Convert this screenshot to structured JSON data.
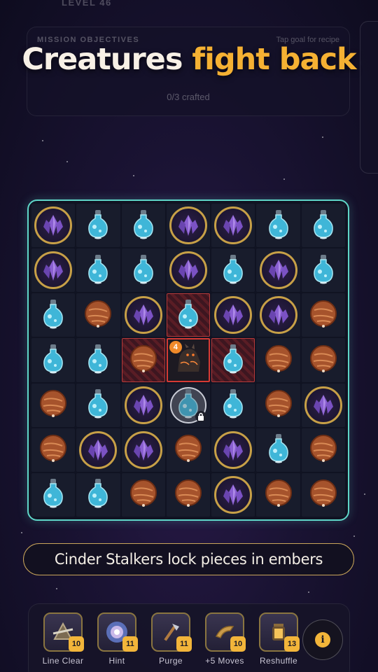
{
  "header": {
    "level_label": "LEVEL 46",
    "mission_title": "MISSION OBJECTIVES",
    "mission_hint": "Tap goal for recipe",
    "mission_progress": "0/3 crafted"
  },
  "headline": {
    "part1": "Creatures",
    "part2": "fight back"
  },
  "board": {
    "rows": 7,
    "cols": 7,
    "cells": [
      [
        "crystal",
        "potion",
        "potion",
        "crystal",
        "crystal",
        "potion",
        "potion"
      ],
      [
        "crystal",
        "potion",
        "potion",
        "crystal",
        "potion",
        "crystal",
        "potion"
      ],
      [
        "potion",
        "orb",
        "crystal",
        "potion",
        "crystal",
        "crystal",
        "orb"
      ],
      [
        "potion",
        "potion",
        "orb",
        "creature",
        "potion",
        "orb",
        "orb"
      ],
      [
        "orb",
        "potion",
        "crystal",
        "potion",
        "potion",
        "orb",
        "crystal"
      ],
      [
        "orb",
        "crystal",
        "crystal",
        "orb",
        "crystal",
        "potion",
        "orb"
      ],
      [
        "potion",
        "potion",
        "orb",
        "orb",
        "crystal",
        "orb",
        "orb"
      ]
    ],
    "ember_cells": [
      [
        2,
        3
      ],
      [
        3,
        2
      ],
      [
        3,
        4
      ]
    ],
    "creature": {
      "row": 3,
      "col": 3,
      "counter": "4",
      "name": "cinder-stalker"
    },
    "locked_cell": {
      "row": 4,
      "col": 3
    },
    "colors": {
      "crystal_ring": "#c7a047",
      "board_border": "#5fd6c8",
      "ember": "#b63a3a",
      "creature_border": "#d63a34"
    }
  },
  "caption": "Cinder Stalkers lock pieces in embers",
  "toolbar": {
    "items": [
      {
        "label": "Line Clear",
        "count": "10",
        "icon": "line-clear-icon"
      },
      {
        "label": "Hint",
        "count": "11",
        "icon": "hint-icon"
      },
      {
        "label": "Purge",
        "count": "11",
        "icon": "purge-icon"
      },
      {
        "label": "+5 Moves",
        "count": "10",
        "icon": "moves-icon"
      },
      {
        "label": "Reshuffle",
        "count": "13",
        "icon": "reshuffle-icon"
      }
    ],
    "info_glyph": "i"
  }
}
